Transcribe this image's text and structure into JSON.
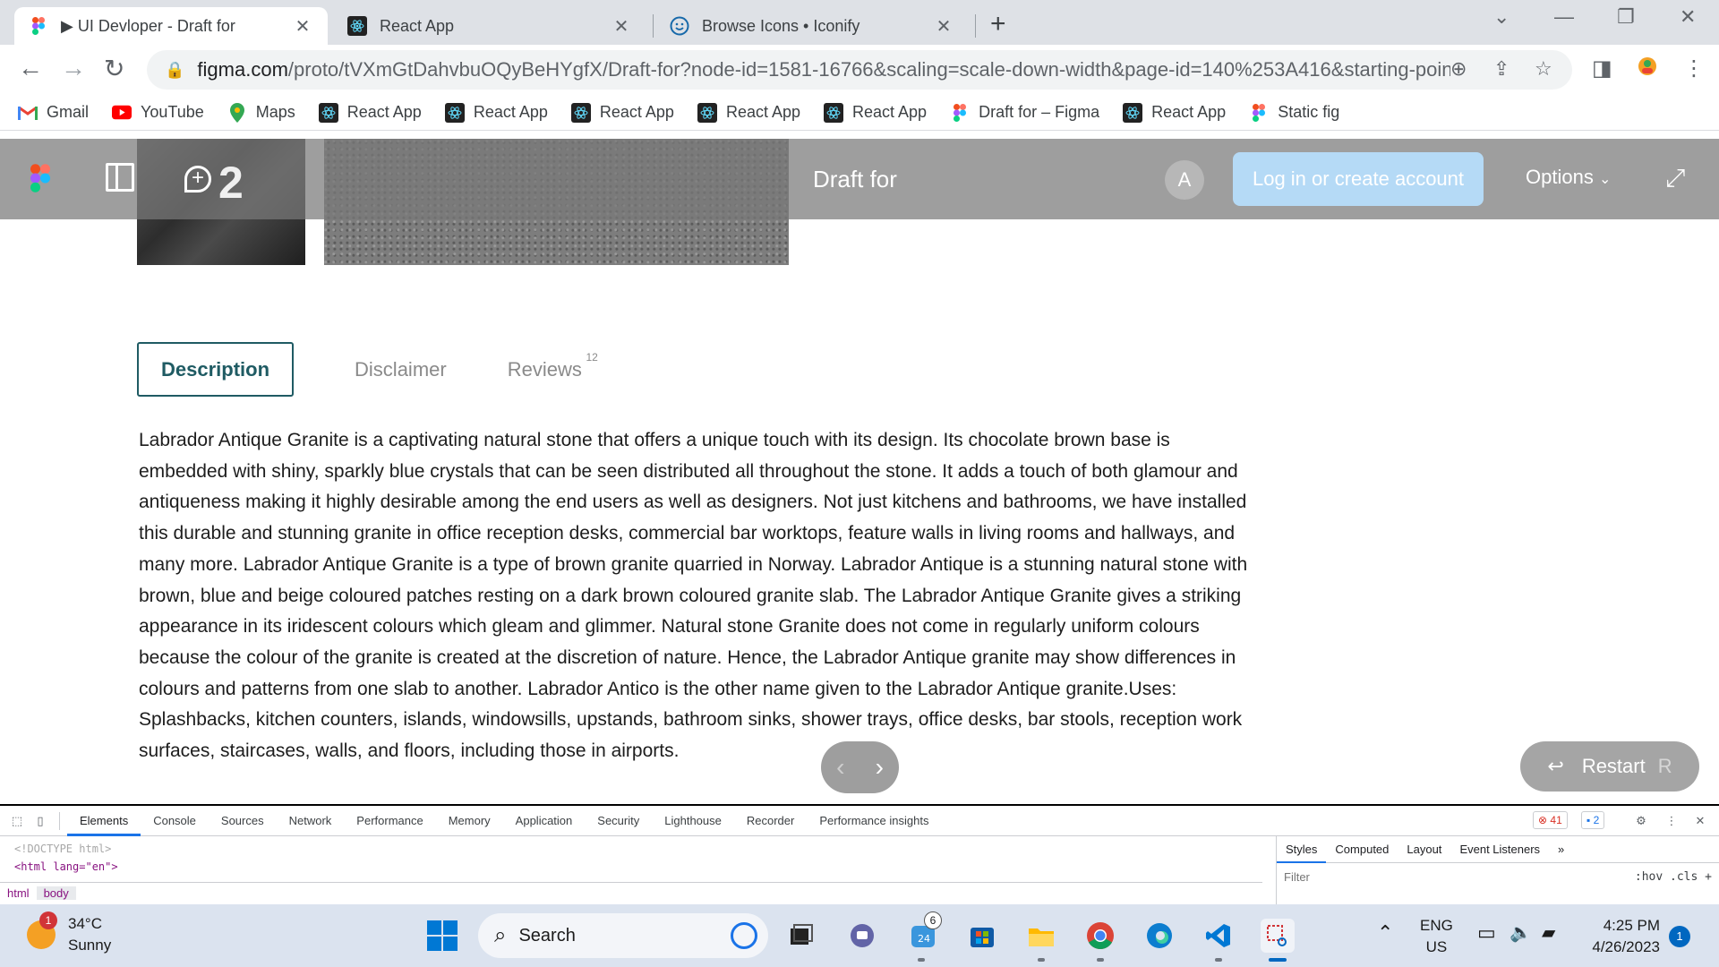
{
  "browser": {
    "tabs": [
      {
        "title": "▶ UI Devloper - Draft for",
        "icon": "figma-icon"
      },
      {
        "title": "React App",
        "icon": "react-icon"
      },
      {
        "title": "Browse Icons • Iconify",
        "icon": "smiley-icon"
      }
    ],
    "url_host": "figma.com",
    "url_path": "/proto/tVXmGtDahvbuOQyBeHYgfX/Draft-for?node-id=1581-16766&scaling=scale-down-width&page-id=140%253A416&starting-point-...",
    "bookmarks": [
      {
        "label": "Gmail",
        "icon": "gmail-icon"
      },
      {
        "label": "YouTube",
        "icon": "youtube-icon"
      },
      {
        "label": "Maps",
        "icon": "maps-icon"
      },
      {
        "label": "React App",
        "icon": "react-icon"
      },
      {
        "label": "React App",
        "icon": "react-icon"
      },
      {
        "label": "React App",
        "icon": "react-icon"
      },
      {
        "label": "React App",
        "icon": "react-icon"
      },
      {
        "label": "React App",
        "icon": "react-icon"
      },
      {
        "label": "Draft for – Figma",
        "icon": "figma-icon"
      },
      {
        "label": "React App",
        "icon": "react-icon"
      },
      {
        "label": "Static fig",
        "icon": "figma-icon"
      }
    ]
  },
  "figma": {
    "doc_title": "Draft for",
    "comment_count": "2",
    "avatar_letter": "A",
    "login_label": "Log in or create account",
    "options_label": "Options",
    "restart_label": "Restart",
    "restart_key": "R"
  },
  "product": {
    "tabs": [
      {
        "label": "Description",
        "active": true
      },
      {
        "label": "Disclaimer",
        "active": false
      },
      {
        "label": "Reviews",
        "badge": "12",
        "active": false
      }
    ],
    "description": "Labrador Antique Granite is a captivating natural stone that offers a unique touch with its design. Its chocolate brown base is embedded with shiny, sparkly blue crystals that can be seen distributed all throughout the stone. It adds a touch of both glamour and antiqueness making it highly desirable among the end users as well as designers. Not just kitchens and bathrooms, we have installed this durable and stunning granite in office reception desks, commercial bar worktops, feature walls in living rooms and hallways, and many more. Labrador Antique Granite is a type of brown granite quarried in Norway. Labrador Antique is a stunning natural stone with brown, blue and beige coloured patches resting on a dark brown coloured granite slab. The Labrador Antique Granite gives a striking appearance in its iridescent colours which gleam and glimmer. Natural stone Granite does not come in regularly uniform colours because the colour of the granite is created at the discretion of nature. Hence, the Labrador Antique granite may show differences in colours and patterns from one slab to another. Labrador Antico is the other name given to the Labrador Antique granite.Uses: Splashbacks, kitchen counters, islands, windowsills, upstands, bathroom sinks, shower trays, office desks, bar stools, reception work surfaces, staircases, walls, and floors, including those in airports."
  },
  "devtools": {
    "tabs": [
      "Elements",
      "Console",
      "Sources",
      "Network",
      "Performance",
      "Memory",
      "Application",
      "Security",
      "Lighthouse",
      "Recorder",
      "Performance insights"
    ],
    "errors": "41",
    "messages": "2",
    "code_line1": "<!DOCTYPE html>",
    "code_line2": "<html lang=\"en\">",
    "crumbs": [
      "html",
      "body"
    ],
    "side_tabs": [
      "Styles",
      "Computed",
      "Layout",
      "Event Listeners"
    ],
    "filter_placeholder": "Filter",
    "hov": ":hov",
    "cls": ".cls"
  },
  "taskbar": {
    "temperature": "34°C",
    "condition": "Sunny",
    "weather_badge": "1",
    "search_label": "Search",
    "calendar_badge": "6",
    "lang1": "ENG",
    "lang2": "US",
    "time": "4:25 PM",
    "date": "4/26/2023",
    "notification_count": "1"
  }
}
